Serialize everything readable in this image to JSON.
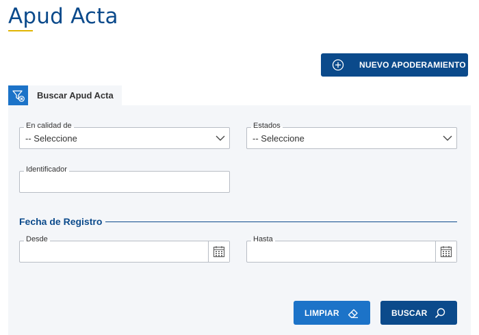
{
  "page": {
    "title": "Apud Acta"
  },
  "toolbar": {
    "new_label": "NUEVO APODERAMIENTO"
  },
  "tab": {
    "label": "Buscar Apud Acta"
  },
  "form": {
    "calidad": {
      "label": "En calidad de",
      "value": "-- Seleccione"
    },
    "estados": {
      "label": "Estados",
      "value": "-- Seleccione"
    },
    "identificador": {
      "label": "Identificador",
      "value": ""
    },
    "section_title": "Fecha de Registro",
    "desde": {
      "label": "Desde",
      "value": ""
    },
    "hasta": {
      "label": "Hasta",
      "value": ""
    }
  },
  "actions": {
    "clear_label": "LIMPIAR",
    "search_label": "BUSCAR"
  },
  "colors": {
    "primary": "#0b4a8b",
    "accent": "#1c73c8",
    "underline": "#e0b400",
    "panel": "#f4f6f9"
  }
}
